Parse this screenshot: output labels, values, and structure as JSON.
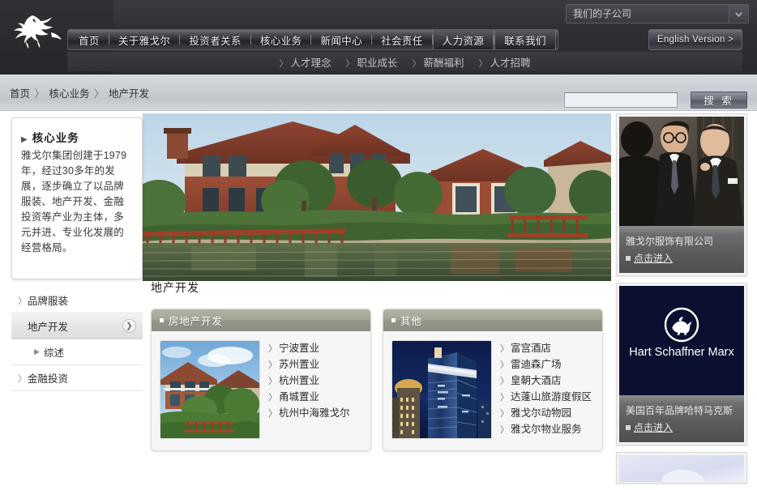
{
  "header": {
    "logo_name": "winged-horse-logo",
    "subsidiary_select": {
      "value": "我们的子公司",
      "caret_icon": "chevron-down-icon"
    },
    "nav_items": [
      {
        "label": "首页",
        "active": false
      },
      {
        "label": "关于雅戈尔",
        "active": false
      },
      {
        "label": "投资者关系",
        "active": false
      },
      {
        "label": "核心业务",
        "active": false
      },
      {
        "label": "新闻中心",
        "active": false
      },
      {
        "label": "社会责任",
        "active": false
      },
      {
        "label": "人力资源",
        "active": true
      },
      {
        "label": "联系我们",
        "active": true
      }
    ],
    "english_button": "English Version >",
    "sub_nav": [
      {
        "label": "人才理念"
      },
      {
        "label": "职业成长"
      },
      {
        "label": "薪酬福利"
      },
      {
        "label": "人才招聘"
      }
    ]
  },
  "strip": {
    "breadcrumb": [
      "首页",
      "核心业务",
      "地产开发"
    ],
    "breadcrumb_separator": "〉",
    "search": {
      "value": "",
      "placeholder": "",
      "button_label": "搜 索"
    }
  },
  "intro": {
    "title": "核心业务",
    "title_marker": "▶",
    "text": "雅戈尔集团创建于1979年，经过30多年的发展，逐步确立了以品牌服装、地产开发、金融投资等产业为主体，多元并进、专业化发展的经营格局。"
  },
  "hero": {
    "name": "villa-waterfront-photo",
    "alt": "红砖别墅与湖景"
  },
  "left_menu": [
    {
      "label": "品牌服装",
      "type": "top",
      "selected": false
    },
    {
      "label": "地产开发",
      "type": "top",
      "selected": true
    },
    {
      "label": "综述",
      "type": "sub",
      "selected": false
    },
    {
      "label": "金融投资",
      "type": "top",
      "selected": false
    }
  ],
  "content": {
    "title": "地产开发",
    "panels": [
      {
        "heading": "房地产开发",
        "thumb_name": "villa-house-thumbnail",
        "links": [
          "宁波置业",
          "苏州置业",
          "杭州置业",
          "甬城置业",
          "杭州中海雅戈尔"
        ]
      },
      {
        "heading": "其他",
        "thumb_name": "skyscraper-night-thumbnail",
        "links": [
          "富宫酒店",
          "雷迪森广场",
          "皇朝大酒店",
          "达蓬山旅游度假区",
          "雅戈尔动物园",
          "雅戈尔物业服务"
        ]
      }
    ]
  },
  "rail": [
    {
      "image_name": "businessmen-suits-photo",
      "title": "雅戈尔服饰有限公司",
      "link": "点击进入"
    },
    {
      "image_name": "hart-schaffner-marx-logo",
      "logo_text": "Hart Schaffner Marx",
      "title": "美国百年品牌哈特马克斯",
      "link": "点击进入"
    },
    {
      "image_name": "third-brand-photo",
      "title": "",
      "link": ""
    }
  ],
  "colors": {
    "header_dark": "#2f2f34",
    "strip_gray": "#ccd1d7",
    "panel_head_olive": "#a3a396",
    "rail_caption_gray": "#5a5a5a",
    "hsm_navy": "#0b1030"
  }
}
